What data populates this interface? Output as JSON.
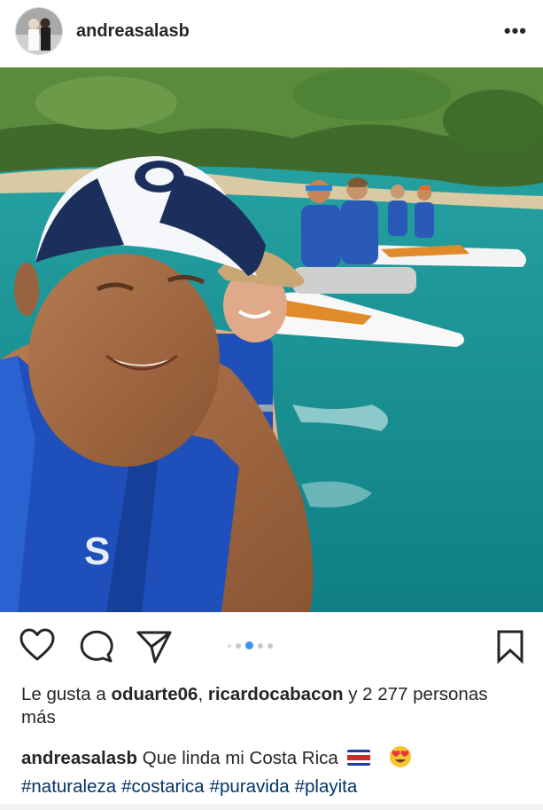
{
  "post": {
    "username": "andreasalasb",
    "more_label": "•••"
  },
  "carousel": {
    "total": 5,
    "active": 2
  },
  "likes": {
    "prefix": "Le gusta a ",
    "user1": "oduarte06",
    "separator": ", ",
    "user2": "ricardocabacon",
    "suffix": " y 2 277 personas más"
  },
  "caption": {
    "username": "andreasalasb",
    "text": "Que linda mi Costa Rica",
    "hashtags": [
      "#naturaleza",
      "#costarica",
      "#puravida",
      "#playita"
    ]
  },
  "icons": [
    "heart-icon",
    "comment-icon",
    "share-icon",
    "bookmark-icon",
    "more-icon",
    "costa-rica-flag-icon",
    "heart-eyes-emoji-icon"
  ],
  "colors": {
    "link": "#003569",
    "carousel_active": "#3897f0",
    "text": "#262626"
  }
}
